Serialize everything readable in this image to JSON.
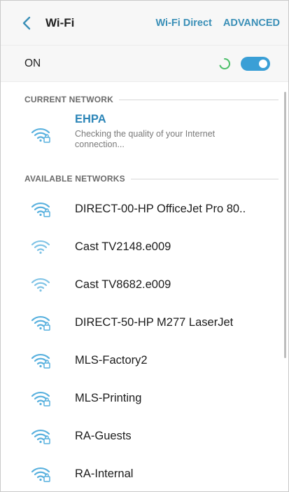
{
  "header": {
    "title": "Wi-Fi",
    "wifi_direct": "Wi-Fi Direct",
    "advanced": "ADVANCED"
  },
  "toggle": {
    "label": "ON",
    "state": "on"
  },
  "current_network": {
    "section_title": "CURRENT NETWORK",
    "name": "EHPA",
    "status": "Checking the quality of your Internet connection..."
  },
  "available_networks": {
    "section_title": "AVAILABLE NETWORKS",
    "items": [
      {
        "name": "DIRECT-00-HP OfficeJet Pro 80..",
        "secured": true,
        "icon": "wifi-lock-icon"
      },
      {
        "name": "Cast TV2148.e009",
        "secured": false,
        "icon": "wifi-icon"
      },
      {
        "name": "Cast TV8682.e009",
        "secured": false,
        "icon": "wifi-icon"
      },
      {
        "name": "DIRECT-50-HP M277 LaserJet",
        "secured": true,
        "icon": "wifi-lock-icon"
      },
      {
        "name": "MLS-Factory2",
        "secured": true,
        "icon": "wifi-lock-icon"
      },
      {
        "name": "MLS-Printing",
        "secured": true,
        "icon": "wifi-lock-icon"
      },
      {
        "name": "RA-Guests",
        "secured": true,
        "icon": "wifi-lock-icon"
      },
      {
        "name": "RA-Internal",
        "secured": true,
        "icon": "wifi-lock-icon"
      }
    ]
  },
  "colors": {
    "accent": "#3a8fb7",
    "switch": "#3a9fd6",
    "current_name": "#2d86b8"
  }
}
